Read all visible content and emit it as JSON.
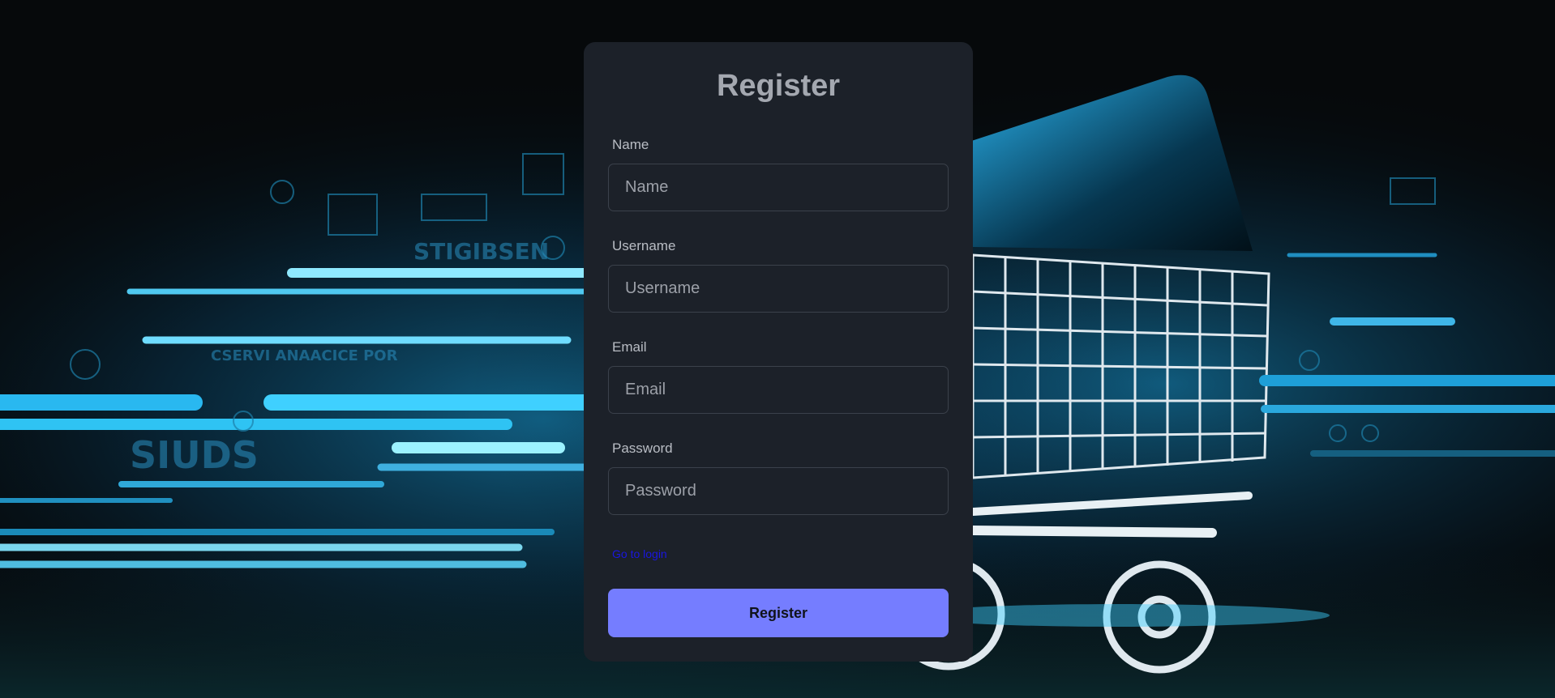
{
  "form": {
    "title": "Register",
    "fields": [
      {
        "label": "Name",
        "placeholder": "Name",
        "value": ""
      },
      {
        "label": "Username",
        "placeholder": "Username",
        "value": ""
      },
      {
        "label": "Email",
        "placeholder": "Email",
        "value": ""
      },
      {
        "label": "Password",
        "placeholder": "Password",
        "value": ""
      }
    ],
    "login_link": "Go to login",
    "submit_label": "Register"
  },
  "colors": {
    "card_background": "#1c2129",
    "button_accent": "#757dff",
    "link": "#1a16e0",
    "background_glow": "#19c8ff"
  }
}
